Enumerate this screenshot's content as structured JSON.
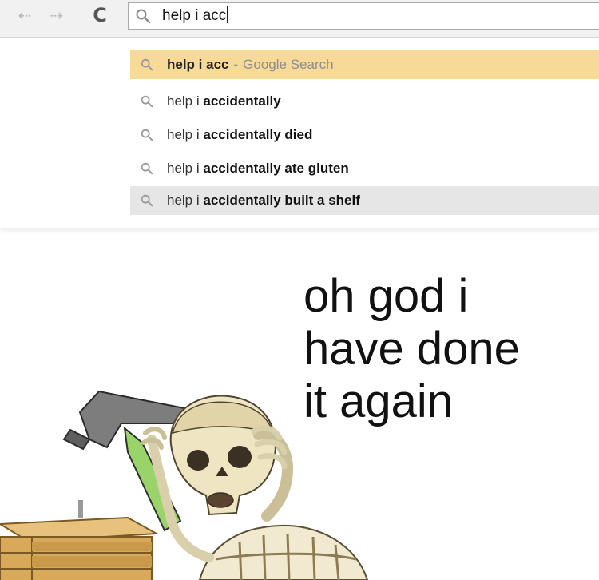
{
  "browser": {
    "back_glyph": "⇠",
    "forward_glyph": "⇢",
    "reload_glyph": "C",
    "omnibox": {
      "icon": "search-icon",
      "value": "help i acc"
    }
  },
  "suggestions": [
    {
      "typed": "help i acc",
      "rest": "",
      "separator": "-",
      "description": "Google Search",
      "icon": "search-icon",
      "highlighted": true
    },
    {
      "typed": "help i ",
      "rest": "accidentally",
      "separator": "",
      "description": "",
      "icon": "search-icon"
    },
    {
      "typed": "help i ",
      "rest": "accidentally died",
      "separator": "",
      "description": "",
      "icon": "search-icon"
    },
    {
      "typed": "help i ",
      "rest": "accidentally ate gluten",
      "separator": "",
      "description": "",
      "icon": "search-icon"
    },
    {
      "typed": "help i ",
      "rest": "accidentally built a shelf",
      "separator": "",
      "description": "",
      "icon": "search-icon",
      "hovered": true
    }
  ],
  "caption": {
    "line1": "oh god i",
    "line2": "have done",
    "line3": "it again"
  },
  "colors": {
    "highlight": "#f7d998",
    "hover": "#e6e6e6",
    "toolbar": "#f1f1f1"
  },
  "illustration": {
    "subject": "skeleton-with-hammer-and-shelf"
  }
}
